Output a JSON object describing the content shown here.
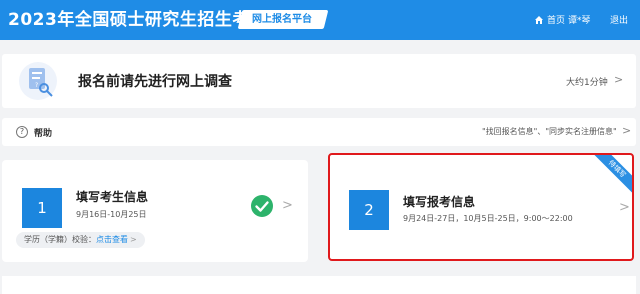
{
  "header": {
    "title": "2023年全国硕士研究生招生考试",
    "platform": "网上报名平台",
    "nav": {
      "home": "首页",
      "user": "谭*琴",
      "logout": "退出"
    }
  },
  "survey": {
    "title": "报名前请先进行网上调查",
    "time": "大约1分钟"
  },
  "help": {
    "label": "帮助",
    "links": "\"找回报名信息\"、\"同步实名注册信息\""
  },
  "steps": [
    {
      "number": "1",
      "title": "填写考生信息",
      "dates": "9月16日-10月25日",
      "verify_label": "学历（学籍）校验：",
      "verify_link": "点击查看",
      "status": "completed"
    },
    {
      "number": "2",
      "title": "填写报考信息",
      "dates": "9月24日-27日，10月5日-25日，9:00～22:00",
      "ribbon": "待填写",
      "highlighted": true
    }
  ],
  "colors": {
    "header_bg": "#1f8ce6",
    "step_box": "#1c86de",
    "highlight_border": "#e0191c",
    "check_green": "#2db36b"
  }
}
